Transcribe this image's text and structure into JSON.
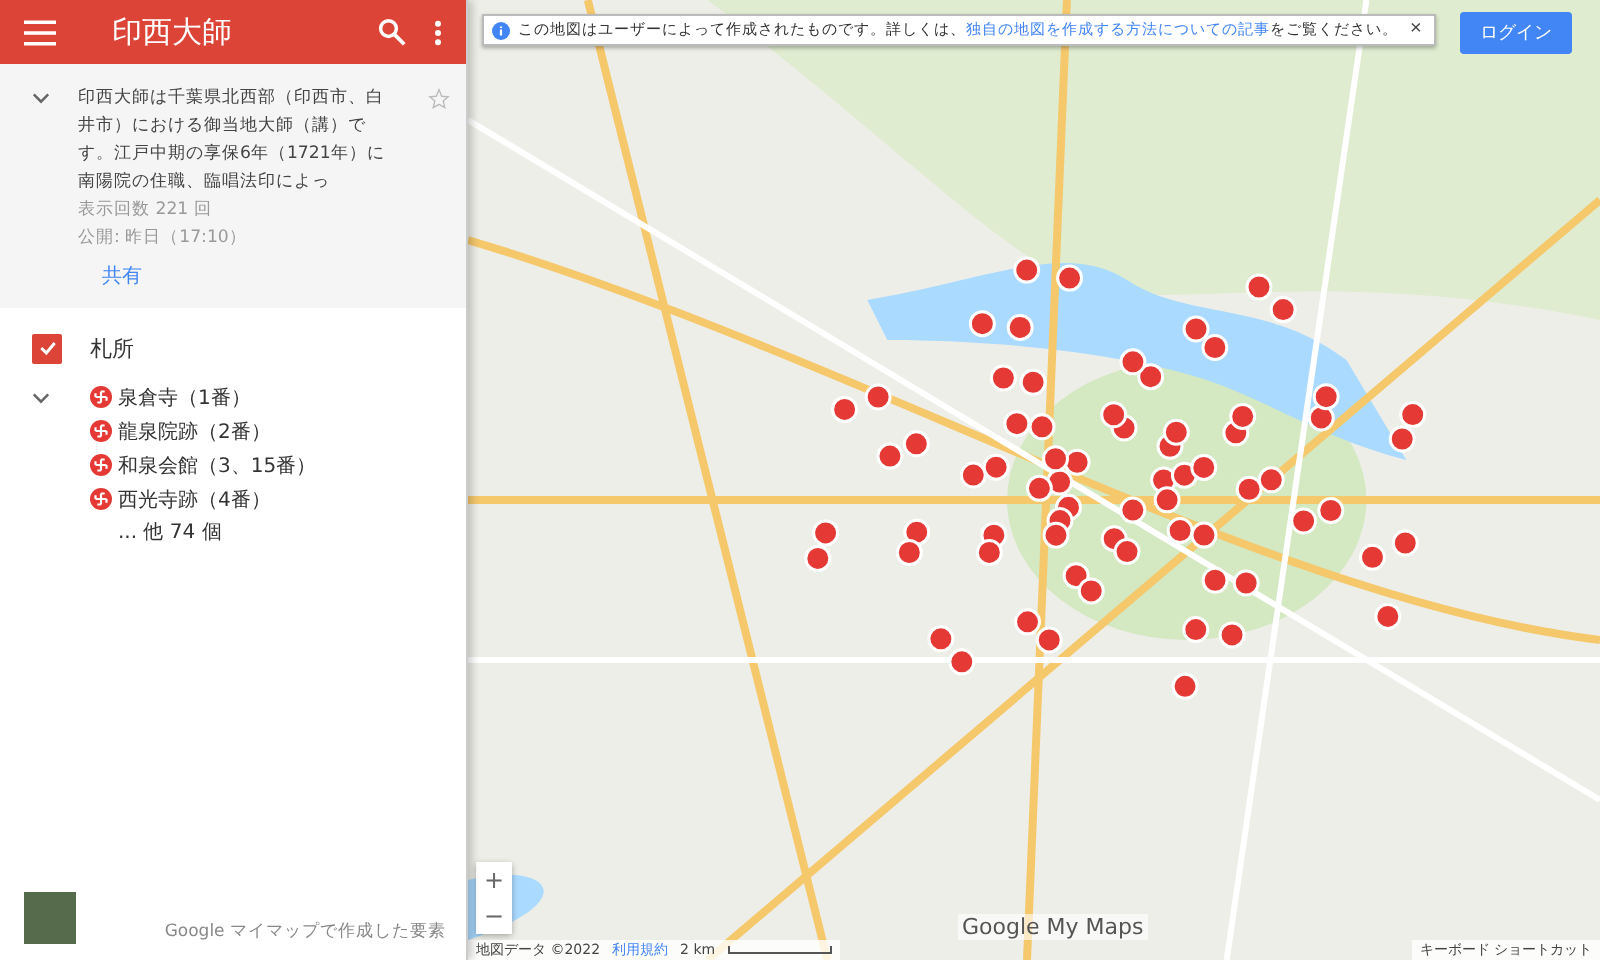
{
  "header": {
    "title": "印西大師"
  },
  "description": {
    "expanded": true,
    "text": "印西大師は千葉県北西部（印西市、白井市）における御当地大師（講）です。江戸中期の享保6年（1721年）に南陽院の住職、臨唱法印によっ",
    "views": "表示回数 221 回",
    "published": "公開: 昨日（17:10）",
    "share": "共有",
    "starred": false
  },
  "layer": {
    "name": "札所",
    "checked": true,
    "expanded": true,
    "items": [
      {
        "label": "泉倉寺（1番）"
      },
      {
        "label": "龍泉院跡（2番）"
      },
      {
        "label": "和泉会館（3、15番）"
      },
      {
        "label": "西光寺跡（4番）"
      }
    ],
    "more": "... 他 74 個"
  },
  "footer": {
    "caption": "Google マイマップで作成した要素"
  },
  "map": {
    "notice": {
      "before": "この地図はユーザーによって作成されたものです。詳しくは、",
      "link": "独自の地図を作成する方法についての記事",
      "after": "をご覧ください。",
      "close": "×"
    },
    "login": "ログイン",
    "zoom_in": "+",
    "zoom_out": "−",
    "logo": "Google My Maps",
    "attribution": "地図データ ©2022",
    "terms": "利用規約",
    "scale": "2 km",
    "shortcuts": "キーボード ショートカット"
  }
}
